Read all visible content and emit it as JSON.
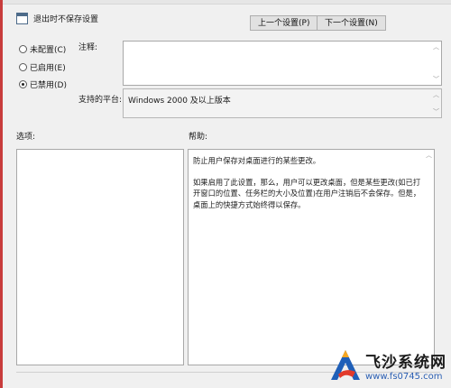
{
  "dialog": {
    "title": "退出时不保存设置",
    "prev_button": "上一个设置(P)",
    "next_button": "下一个设置(N)"
  },
  "state_options": [
    {
      "label": "未配置(C)",
      "selected": false
    },
    {
      "label": "已启用(E)",
      "selected": false
    },
    {
      "label": "已禁用(D)",
      "selected": true
    }
  ],
  "comment": {
    "label": "注释:",
    "value": ""
  },
  "supported": {
    "label": "支持的平台:",
    "value": "Windows 2000 及以上版本"
  },
  "options": {
    "label": "选项:"
  },
  "help": {
    "label": "帮助:",
    "paragraph1": "防止用户保存对桌面进行的某些更改。",
    "paragraph2": "如果启用了此设置，那么，用户可以更改桌面，但是某些更改(如已打开窗口的位置、任务栏的大小及位置)在用户注销后不会保存。但是，桌面上的快捷方式始终得以保存。"
  },
  "watermark": {
    "name": "飞沙系统网",
    "url": "www.fs0745.com"
  }
}
